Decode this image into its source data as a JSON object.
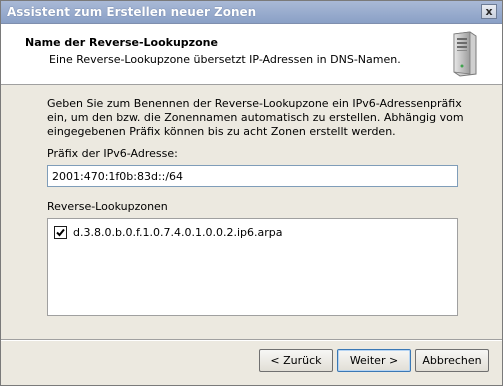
{
  "window": {
    "title": "Assistent zum Erstellen neuer Zonen",
    "close_glyph": "x"
  },
  "header": {
    "title": "Name der Reverse-Lookupzone",
    "subtitle": "Eine Reverse-Lookupzone übersetzt IP-Adressen in DNS-Namen.",
    "icon": "server-icon"
  },
  "content": {
    "description": "Geben Sie zum Benennen der Reverse-Lookupzone ein IPv6-Adressenpräfix ein, um den bzw. die Zonennamen automatisch zu erstellen. Abhängig vom eingegebenen Präfix können bis zu acht Zonen erstellt werden.",
    "prefix_label": "Präfix der IPv6-Adresse:",
    "prefix_value": "2001:470:1f0b:83d::/64",
    "zones_label": "Reverse-Lookupzonen",
    "zones": [
      {
        "name": "d.3.8.0.b.0.f.1.0.7.4.0.1.0.0.2.ip6.arpa",
        "checked": true
      }
    ]
  },
  "buttons": {
    "back": "< Zurück",
    "next": "Weiter >",
    "cancel": "Abbrechen"
  }
}
